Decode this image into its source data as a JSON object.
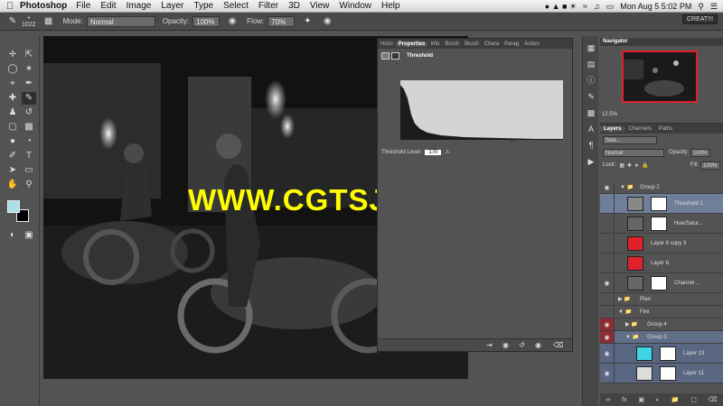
{
  "menubar": {
    "app": "Photoshop",
    "items": [
      "File",
      "Edit",
      "Image",
      "Layer",
      "Type",
      "Select",
      "Filter",
      "3D",
      "View",
      "Window",
      "Help"
    ],
    "clock": "Mon Aug 5  5:02 PM"
  },
  "options": {
    "brush_size": "1022",
    "mode_label": "Mode:",
    "mode_value": "Normal",
    "opacity_label": "Opacity:",
    "opacity_value": "100%",
    "flow_label": "Flow:",
    "flow_value": "70%",
    "workspace": "CREAT!!!"
  },
  "properties": {
    "tabs": [
      "Histo",
      "Properties",
      "Info",
      "Brush",
      "Brush",
      "Chara",
      "Parag",
      "Action"
    ],
    "active_tab": "Properties",
    "title": "Threshold",
    "threshold_label": "Threshold Level:",
    "threshold_value": "170"
  },
  "navigator": {
    "title": "Navigator",
    "zoom": "12.5%"
  },
  "layers_panel": {
    "tabs": [
      "Layers",
      "Channels",
      "Paths"
    ],
    "kind": "Sele...",
    "blend": "Normal",
    "opacity_label": "Opacity:",
    "opacity_value": "100%",
    "lock_label": "Lock:",
    "fill_label": "Fill:",
    "fill_value": "100%",
    "layers": [
      {
        "name": "Group 2",
        "type": "group",
        "eye": true
      },
      {
        "name": "Threshold 1",
        "type": "adjust",
        "eye": false,
        "selected": true
      },
      {
        "name": "Hue/Satur...",
        "type": "adjust",
        "eye": false
      },
      {
        "name": "Layer 6 copy 3",
        "type": "red",
        "eye": false
      },
      {
        "name": "Layer 6",
        "type": "red",
        "eye": false
      },
      {
        "name": "Channel ...",
        "type": "adjust",
        "eye": true
      },
      {
        "name": "Plan",
        "type": "group",
        "eye": false
      },
      {
        "name": "Fire",
        "type": "group",
        "eye": false
      },
      {
        "name": "Group 4",
        "type": "group",
        "eye": true,
        "red_eye": true
      },
      {
        "name": "Group 3",
        "type": "group",
        "eye": true,
        "red_eye": true
      },
      {
        "name": "Layer 13",
        "type": "pixel",
        "eye": true
      },
      {
        "name": "Layer 11",
        "type": "pixel",
        "eye": true
      }
    ]
  },
  "watermark": "WWW.CGTSJ.COM",
  "colors": {
    "foreground": "#a9dfe8",
    "background": "#000000",
    "accent_red": "#e2202c"
  }
}
